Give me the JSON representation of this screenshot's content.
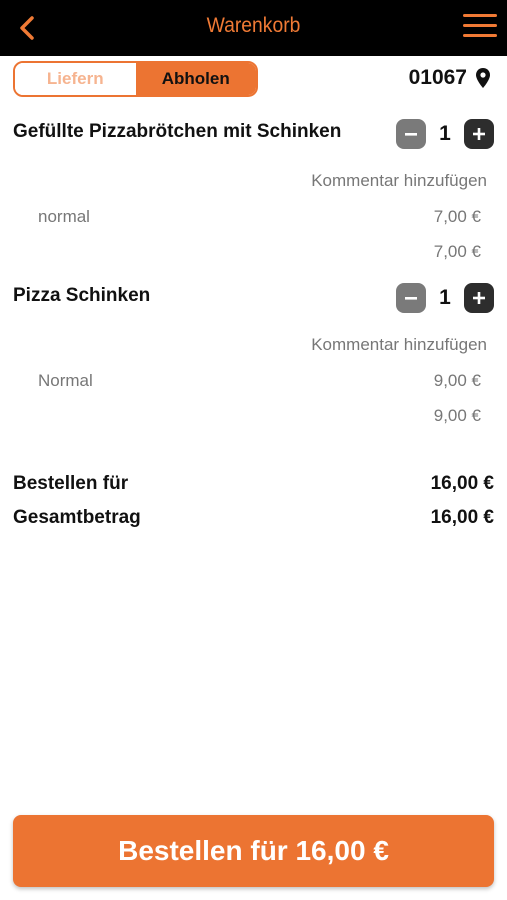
{
  "header": {
    "title": "Warenkorb"
  },
  "delivery_toggle": {
    "deliver_label": "Liefern",
    "pickup_label": "Abholen",
    "selected": "Abholen"
  },
  "location": {
    "postal_code": "01067"
  },
  "items": [
    {
      "name": "Gefüllte Pizzabrötchen mit Schinken",
      "quantity": "1",
      "comment_label": "Kommentar hinzufügen",
      "variant": "normal",
      "variant_price": "7,00 €",
      "total_price": "7,00 €"
    },
    {
      "name": "Pizza Schinken",
      "quantity": "1",
      "comment_label": "Kommentar hinzufügen",
      "variant": "Normal",
      "variant_price": "9,00 €",
      "total_price": "9,00 €"
    }
  ],
  "summary": {
    "order_for_label": "Bestellen für",
    "order_for_value": "16,00 €",
    "total_label": "Gesamtbetrag",
    "total_value": "16,00 €"
  },
  "order_button": {
    "label": "Bestellen für 16,00 €"
  },
  "colors": {
    "accent": "#ec7432",
    "header_bg": "#000000",
    "muted_text": "#777777",
    "minus_button": "#7a7a7a",
    "plus_button": "#2d2d2d"
  }
}
